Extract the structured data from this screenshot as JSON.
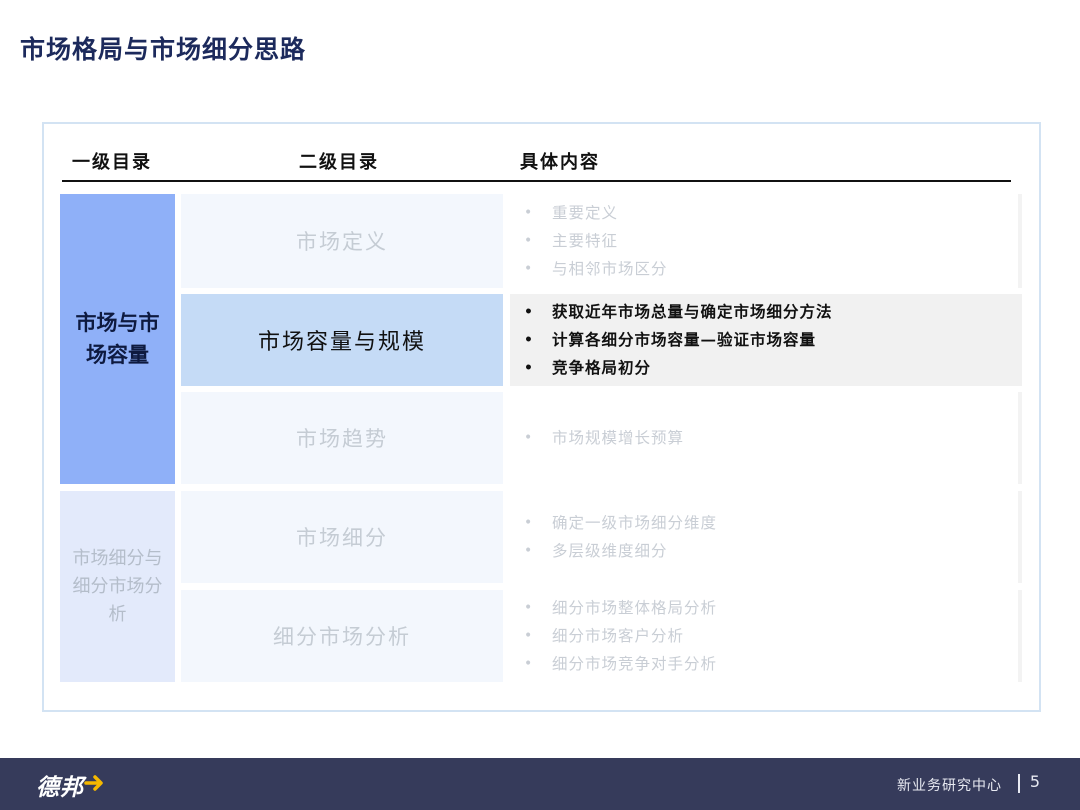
{
  "title": "市场格局与市场细分思路",
  "headers": {
    "level1": "一级目录",
    "level2": "二级目录",
    "content": "具体内容"
  },
  "level1": [
    {
      "label": "市场与市场容量",
      "state": "active"
    },
    {
      "label": "市场细分与细分市场分析",
      "state": "dim"
    }
  ],
  "rows": [
    {
      "level2": "市场定义",
      "state": "dim",
      "items": [
        "重要定义",
        "主要特征",
        "与相邻市场区分"
      ]
    },
    {
      "level2": "市场容量与规模",
      "state": "active",
      "items": [
        "获取近年市场总量与确定市场细分方法",
        "计算各细分市场容量—验证市场容量",
        "竞争格局初分"
      ]
    },
    {
      "level2": "市场趋势",
      "state": "dim",
      "items": [
        "市场规模增长预算"
      ]
    },
    {
      "level2": "市场细分",
      "state": "dim",
      "items": [
        "确定一级市场细分维度",
        "多层级维度细分"
      ]
    },
    {
      "level2": "细分市场分析",
      "state": "dim",
      "items": [
        "细分市场整体格局分析",
        "细分市场客户分析",
        "细分市场竞争对手分析"
      ]
    }
  ],
  "bullet": "•",
  "footer": {
    "logo": "德邦",
    "org": "新业务研究中心",
    "page": "5"
  },
  "colors": {
    "title": "#1c2a5c",
    "active_level1": "#8fb0f8",
    "active_level2": "#c5dbf6",
    "footer_bg": "#363b5b",
    "logo_accent": "#f5b800"
  }
}
